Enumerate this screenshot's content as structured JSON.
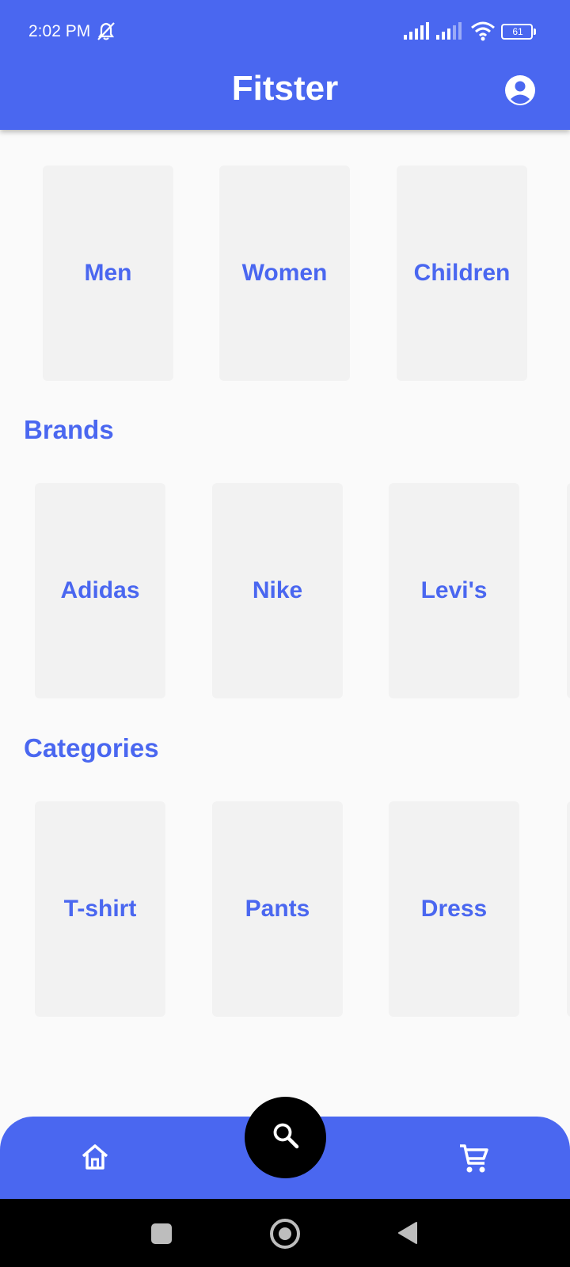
{
  "status_bar": {
    "time": "2:02 PM",
    "battery_level": "61",
    "icons": [
      "mute-icon",
      "signal-icon",
      "signal-icon",
      "wifi-icon",
      "battery-icon"
    ]
  },
  "header": {
    "title": "Fitster",
    "profile_icon": "account-circle-icon",
    "background_color": "#4A67F0"
  },
  "gender": {
    "items": [
      {
        "label": "Men"
      },
      {
        "label": "Women"
      },
      {
        "label": "Children"
      }
    ]
  },
  "brands": {
    "title": "Brands",
    "items": [
      {
        "label": "Adidas"
      },
      {
        "label": "Nike"
      },
      {
        "label": "Levi's"
      }
    ]
  },
  "categories": {
    "title": "Categories",
    "items": [
      {
        "label": "T-shirt"
      },
      {
        "label": "Pants"
      },
      {
        "label": "Dress"
      }
    ]
  },
  "bottom_nav": {
    "items": [
      {
        "icon": "home-icon"
      },
      {
        "icon": "search-icon"
      },
      {
        "icon": "cart-icon"
      }
    ],
    "fab_color": "#000000"
  },
  "system_nav": {
    "items": [
      "recents-button",
      "home-button",
      "back-button"
    ]
  },
  "colors": {
    "primary": "#4A67F0",
    "card_background": "#F2F2F2",
    "page_background": "#FAFAFA"
  }
}
